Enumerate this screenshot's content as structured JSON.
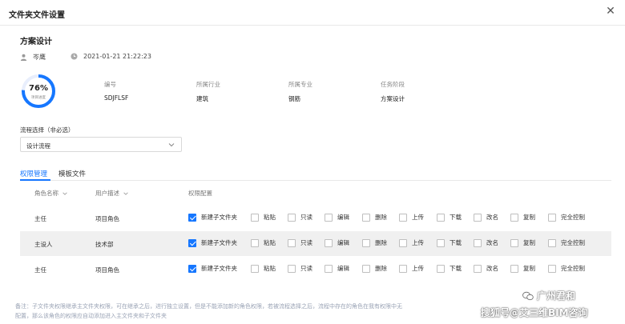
{
  "dialog": {
    "title": "文件夹文件设置"
  },
  "project": {
    "name": "方案设计",
    "user": "岑鹰",
    "datetime": "2021-01-21 21:22:23",
    "progress": {
      "percent_text": "76%",
      "value": 0.76,
      "caption": "项目进度"
    },
    "fields": [
      {
        "label": "编号",
        "value": "SDJFLSF"
      },
      {
        "label": "所属行业",
        "value": "建筑"
      },
      {
        "label": "所属专业",
        "value": "钢筋"
      },
      {
        "label": "任务阶段",
        "value": "方案设计"
      }
    ]
  },
  "process": {
    "label": "流程选择（非必选）",
    "selected": "设计流程"
  },
  "tabs": [
    {
      "label": "权限管理",
      "active": true
    },
    {
      "label": "模板文件",
      "active": false
    }
  ],
  "table": {
    "headers": [
      "角色名称",
      "用户描述",
      "权限配置"
    ],
    "permission_labels": [
      "新建子文件夹",
      "粘贴",
      "只读",
      "编辑",
      "删除",
      "上传",
      "下载",
      "改名",
      "复制",
      "完全控制"
    ],
    "rows": [
      {
        "role": "主任",
        "desc": "项目角色",
        "checks": [
          true,
          false,
          false,
          false,
          false,
          false,
          false,
          false,
          false,
          false
        ]
      },
      {
        "role": "主设人",
        "desc": "技术部",
        "checks": [
          true,
          false,
          false,
          false,
          false,
          false,
          false,
          false,
          false,
          false
        ]
      },
      {
        "role": "主任",
        "desc": "项目角色",
        "checks": [
          true,
          false,
          false,
          false,
          false,
          false,
          false,
          false,
          false,
          false
        ]
      }
    ]
  },
  "note": {
    "line1": "备注：子文件夹权限继承主文件夹权限，可在继承之后，进行独立设置，但是不能添加新的角色权限，若被流程选择之后，流程中存在的角色在我有权限中无",
    "line2": "配置，那么该角色的权限应自动添加进入主文件夹和子文件夹"
  },
  "watermark": {
    "line1": "广州君和",
    "line2": "搜狐号@艾三维BIM咨询"
  },
  "colors": {
    "accent": "#1677ff",
    "ring_track": "#e8eefc",
    "row_alt": "#f0f0f0"
  }
}
